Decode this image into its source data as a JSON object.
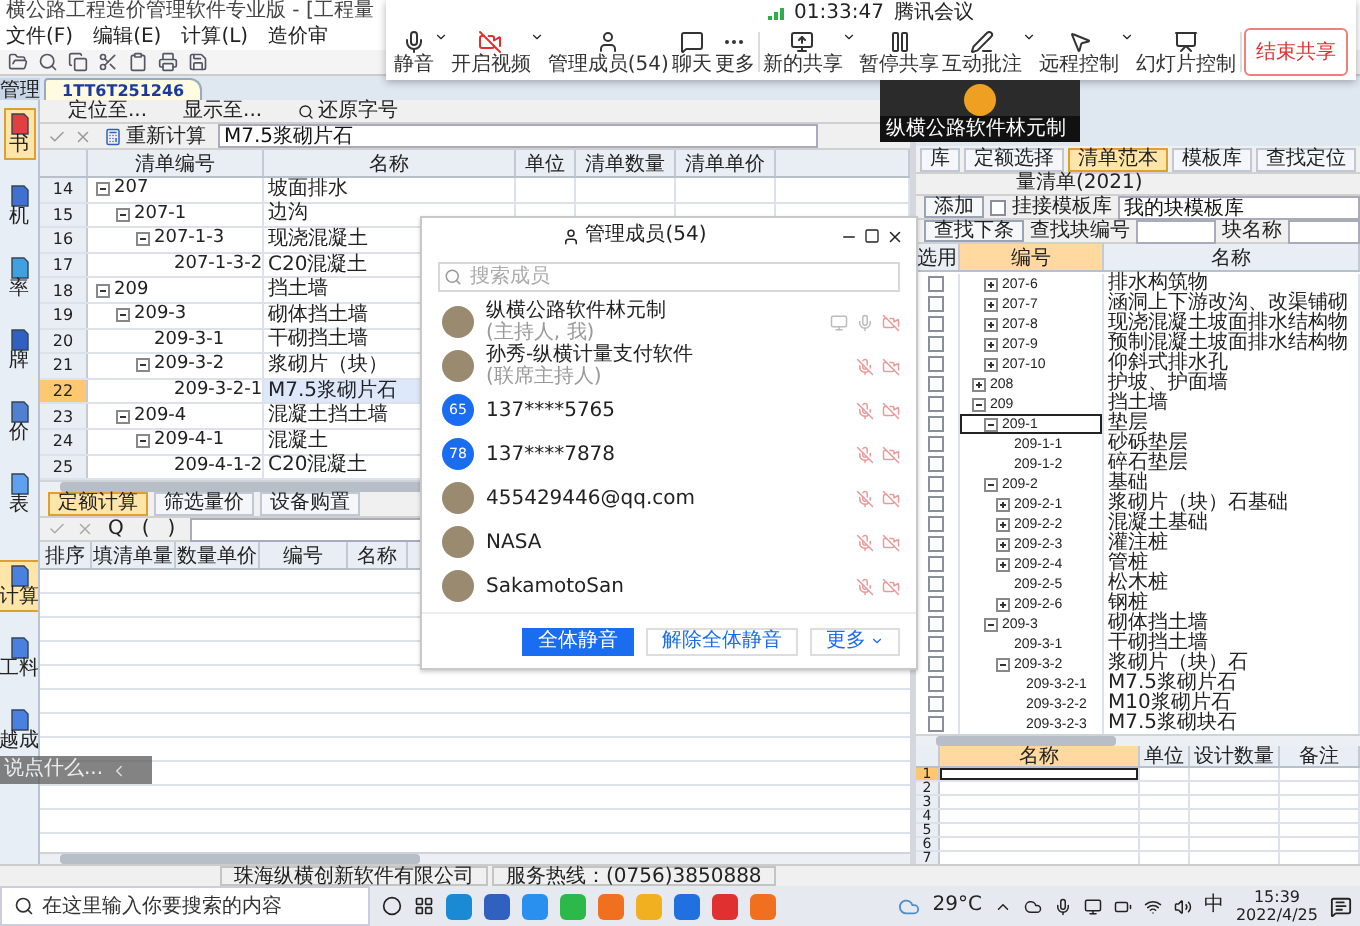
{
  "window": {
    "title": "横公路工程造价管理软件专业版 - [工程量"
  },
  "menu": [
    "文件(F)",
    "编辑(E)",
    "计算(L)",
    "造价审"
  ],
  "manage_tab": "管理",
  "document_tab": {
    "label": "1TT6T251246",
    "selected": true
  },
  "sidebar": {
    "items": [
      {
        "label": "书",
        "selected": true
      },
      {
        "label": "机",
        "selected": false
      },
      {
        "label": "率",
        "selected": false
      },
      {
        "label": "牌",
        "selected": false
      },
      {
        "label": "价",
        "selected": false
      },
      {
        "label": "表",
        "selected": false
      }
    ],
    "bottom_items": [
      {
        "label": "计算",
        "selected": true
      },
      {
        "label": "工料",
        "selected": false
      },
      {
        "label": "越成",
        "selected": false
      }
    ]
  },
  "bill_pane": {
    "toolbar": [
      "定位至...",
      "显示至...",
      "还原字号"
    ],
    "recalc": "重新计算",
    "value": "M7.5浆砌片石",
    "columns": [
      "清单编号",
      "名称",
      "单位",
      "清单数量",
      "清单单价"
    ],
    "rows": [
      {
        "row": "14",
        "code": "207",
        "name": "坡面排水",
        "expanded": true,
        "selected": false,
        "children": [
          {
            "row": "15",
            "code": "207-1",
            "name": "边沟",
            "expanded": true,
            "selected": false,
            "children": [
              {
                "row": "16",
                "code": "207-1-3",
                "name": "现浇混凝土",
                "expanded": true,
                "selected": false,
                "children": [
                  {
                    "row": "17",
                    "code": "207-1-3-2",
                    "name": "C20混凝土",
                    "selected": false
                  }
                ]
              }
            ]
          }
        ]
      },
      {
        "row": "18",
        "code": "209",
        "name": "挡土墙",
        "expanded": true,
        "selected": false,
        "children": [
          {
            "row": "19",
            "code": "209-3",
            "name": "砌体挡土墙",
            "expanded": true,
            "selected": false,
            "children": [
              {
                "row": "20",
                "code": "209-3-1",
                "name": "干砌挡土墙",
                "selected": false
              },
              {
                "row": "21",
                "code": "209-3-2",
                "name": "浆砌片（块）",
                "expanded": true,
                "selected": false,
                "children": [
                  {
                    "row": "22",
                    "code": "209-3-2-1",
                    "name": "M7.5浆砌片石",
                    "selected": true
                  }
                ]
              }
            ]
          },
          {
            "row": "23",
            "code": "209-4",
            "name": "混凝土挡土墙",
            "expanded": true,
            "selected": false,
            "children": [
              {
                "row": "24",
                "code": "209-4-1",
                "name": "混凝土",
                "expanded": true,
                "selected": false,
                "children": [
                  {
                    "row": "25",
                    "code": "209-4-1-2",
                    "name": "C20混凝土",
                    "selected": false
                  }
                ]
              }
            ]
          }
        ]
      }
    ]
  },
  "quota_pane": {
    "tabs": [
      {
        "label": "定额计算",
        "selected": true
      },
      {
        "label": "筛选量价",
        "selected": false
      },
      {
        "label": "设备购置",
        "selected": false
      }
    ],
    "formula_keys": [
      "Q",
      "(",
      ")"
    ],
    "columns": [
      "排序",
      "填清单量",
      "数量单价",
      "编号",
      "名称"
    ]
  },
  "library_pane": {
    "tabs": [
      {
        "label": "库",
        "selected": false
      },
      {
        "label": "定额选择",
        "selected": false
      },
      {
        "label": "清单范本",
        "selected": true
      },
      {
        "label": "模板库",
        "selected": false
      },
      {
        "label": "查找定位",
        "selected": false
      }
    ],
    "library": "量清单(2021)",
    "add_button": "添加",
    "link_template": {
      "label": "挂接模板库",
      "checked": false
    },
    "template_value": "我的块模板库",
    "find_next": "查找下条",
    "block_code_label": "查找块编号",
    "block_name_label": "块名称",
    "columns": [
      "选用",
      "编号",
      "名称"
    ],
    "tree": {
      "scrolled_children": [
        {
          "code": "207-6",
          "name": "排水构筑物",
          "expanded": false,
          "checked": false,
          "selected": false
        },
        {
          "code": "207-7",
          "name": "涵洞上下游改沟、改渠铺砌",
          "expanded": false,
          "checked": false,
          "selected": false
        },
        {
          "code": "207-8",
          "name": "现浇混凝土坡面排水结构物",
          "expanded": false,
          "checked": false,
          "selected": false
        },
        {
          "code": "207-9",
          "name": "预制混凝土坡面排水结构物",
          "expanded": false,
          "checked": false,
          "selected": false
        },
        {
          "code": "207-10",
          "name": "仰斜式排水孔",
          "expanded": false,
          "checked": false,
          "selected": false
        }
      ],
      "items": [
        {
          "code": "208",
          "name": "护坡、护面墙",
          "expanded": false,
          "checked": false,
          "selected": false
        },
        {
          "code": "209",
          "name": "挡土墙",
          "expanded": true,
          "checked": false,
          "selected": false,
          "children": [
            {
              "code": "209-1",
              "name": "垫层",
              "expanded": true,
              "checked": false,
              "selected": true,
              "children": [
                {
                  "code": "209-1-1",
                  "name": "砂砾垫层",
                  "checked": false,
                  "selected": false
                },
                {
                  "code": "209-1-2",
                  "name": "碎石垫层",
                  "checked": false,
                  "selected": false
                }
              ]
            },
            {
              "code": "209-2",
              "name": "基础",
              "expanded": true,
              "checked": false,
              "selected": false,
              "children": [
                {
                  "code": "209-2-1",
                  "name": "浆砌片（块）石基础",
                  "expanded": false,
                  "checked": false,
                  "selected": false
                },
                {
                  "code": "209-2-2",
                  "name": "混凝土基础",
                  "expanded": false,
                  "checked": false,
                  "selected": false
                },
                {
                  "code": "209-2-3",
                  "name": "灌注桩",
                  "expanded": false,
                  "checked": false,
                  "selected": false
                },
                {
                  "code": "209-2-4",
                  "name": "管桩",
                  "expanded": false,
                  "checked": false,
                  "selected": false
                },
                {
                  "code": "209-2-5",
                  "name": "松木桩",
                  "checked": false,
                  "selected": false
                },
                {
                  "code": "209-2-6",
                  "name": "钢桩",
                  "expanded": false,
                  "checked": false,
                  "selected": false
                }
              ]
            },
            {
              "code": "209-3",
              "name": "砌体挡土墙",
              "expanded": true,
              "checked": false,
              "selected": false,
              "children": [
                {
                  "code": "209-3-1",
                  "name": "干砌挡土墙",
                  "checked": false,
                  "selected": false
                },
                {
                  "code": "209-3-2",
                  "name": "浆砌片（块）石",
                  "expanded": true,
                  "checked": false,
                  "selected": false,
                  "children": [
                    {
                      "code": "209-3-2-1",
                      "name": "M7.5浆砌片石",
                      "checked": false,
                      "selected": false
                    },
                    {
                      "code": "209-3-2-2",
                      "name": "M10浆砌片石",
                      "checked": false,
                      "selected": false
                    },
                    {
                      "code": "209-3-2-3",
                      "name": "M7.5浆砌块石",
                      "checked": false,
                      "selected": false
                    }
                  ]
                }
              ]
            }
          ]
        }
      ]
    }
  },
  "design_grid": {
    "columns": [
      "名称",
      "单位",
      "设计数量",
      "备注"
    ],
    "rows": [
      {
        "label": "1",
        "selected": true
      },
      {
        "label": "2",
        "selected": false
      },
      {
        "label": "3",
        "selected": false
      },
      {
        "label": "4",
        "selected": false
      },
      {
        "label": "5",
        "selected": false
      },
      {
        "label": "6",
        "selected": false
      },
      {
        "label": "7",
        "selected": false
      }
    ]
  },
  "status_bar": [
    "珠海纵横创新软件有限公司",
    "服务热线：(0756)3850888"
  ],
  "meeting_bar": {
    "timer": "01:33:47",
    "app": "腾讯会议",
    "buttons": [
      {
        "label": "静音",
        "kind": "mic",
        "caret": true
      },
      {
        "label": "开启视频",
        "kind": "video",
        "caret": true
      },
      {
        "label": "管理成员(54)",
        "kind": "members",
        "caret": false
      },
      {
        "label": "聊天",
        "kind": "chat",
        "caret": false
      },
      {
        "label": "更多",
        "kind": "more",
        "caret": false
      },
      {
        "label": "新的共享",
        "kind": "share",
        "caret": true
      },
      {
        "label": "暂停共享",
        "kind": "pause",
        "caret": false
      },
      {
        "label": "互动批注",
        "kind": "annotate",
        "caret": true
      },
      {
        "label": "远程控制",
        "kind": "remote",
        "caret": true
      },
      {
        "label": "幻灯片控制",
        "kind": "slides",
        "caret": false
      }
    ],
    "end_button": "结束共享"
  },
  "video_tile": {
    "name": "纵横公路软件林元制"
  },
  "members_dialog": {
    "title": "管理成员(54)",
    "search_placeholder": "搜索成员",
    "members": [
      {
        "name": "纵横公路软件林元制",
        "role": "(主持人, 我)",
        "kind": "photo",
        "sharing": true,
        "muted": false,
        "video_off": true
      },
      {
        "name": "孙秀-纵横计量支付软件",
        "role": "(联席主持人)",
        "kind": "photo",
        "sharing": false,
        "muted": true,
        "video_off": true
      },
      {
        "name": "137****5765",
        "kind": "number",
        "badge": "65",
        "sharing": false,
        "muted": true,
        "video_off": true
      },
      {
        "name": "137****7878",
        "kind": "number",
        "badge": "78",
        "sharing": false,
        "muted": true,
        "video_off": true
      },
      {
        "name": "455429446@qq.com",
        "kind": "photo",
        "sharing": false,
        "muted": true,
        "video_off": true
      },
      {
        "name": "NASA",
        "kind": "photo",
        "sharing": false,
        "muted": true,
        "video_off": true
      },
      {
        "name": "SakamotoSan",
        "kind": "photo",
        "sharing": false,
        "muted": true,
        "video_off": true
      }
    ],
    "buttons": [
      "全体静音",
      "解除全体静音",
      "更多"
    ]
  },
  "chat_hint": "说点什么...",
  "taskbar": {
    "search_placeholder": "在这里输入你要搜索的内容",
    "weather": "29°C",
    "language": "中",
    "time": "15:39",
    "date": "2022/4/25"
  }
}
